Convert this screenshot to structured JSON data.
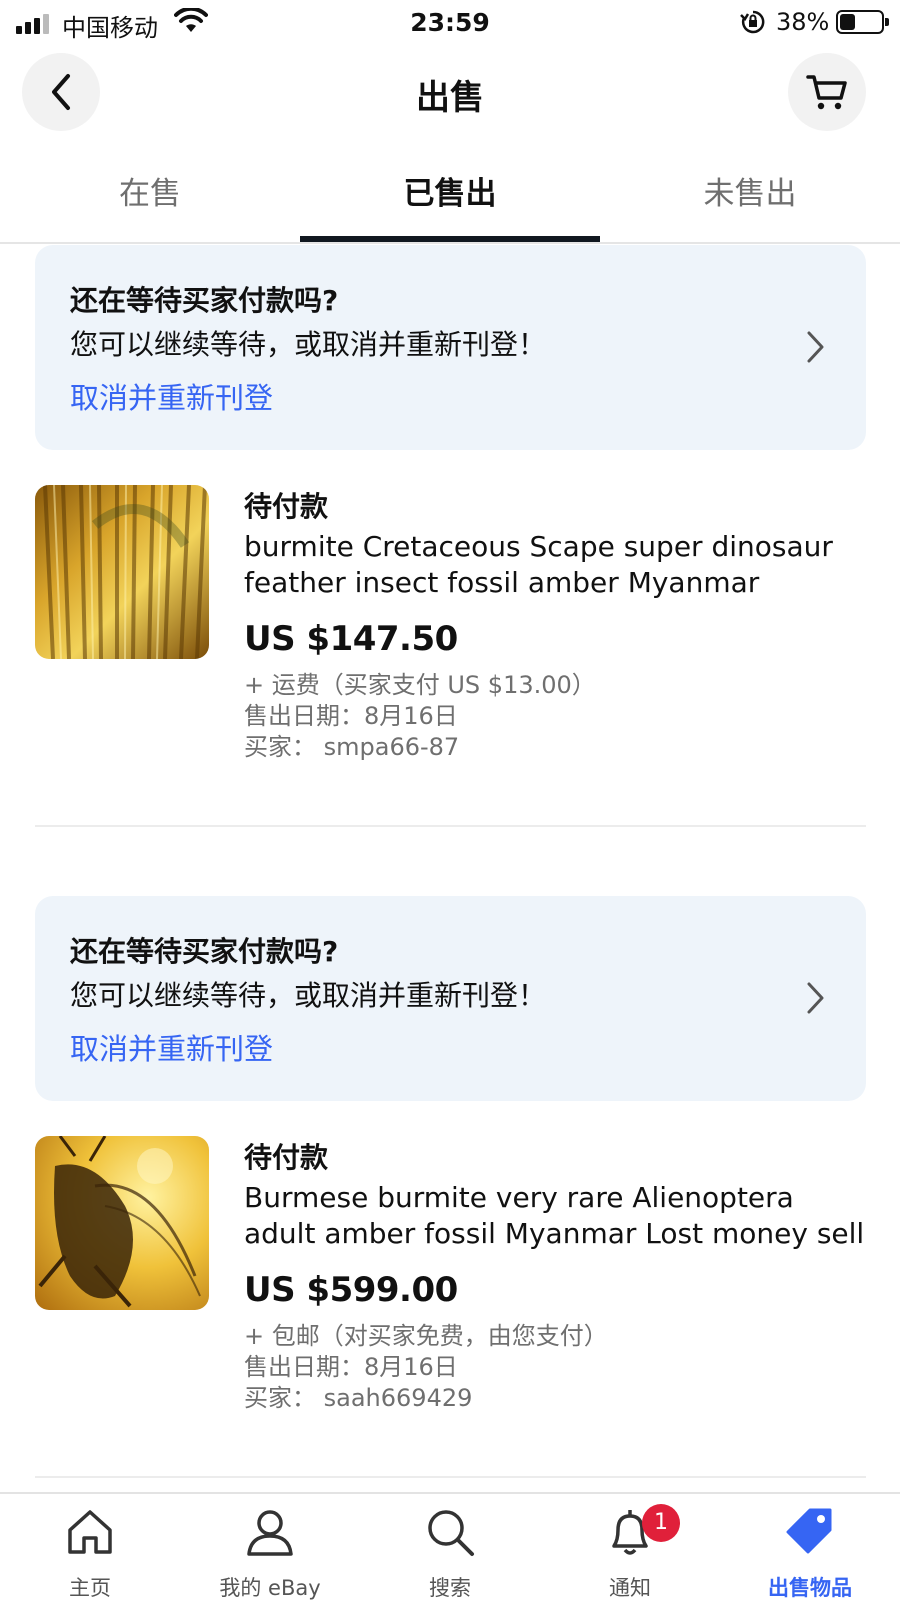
{
  "status_bar": {
    "carrier": "中国移动",
    "time": "23:59",
    "battery_percent": "38%",
    "battery_level": 0.38,
    "icons": [
      "signal-icon",
      "wifi-icon",
      "orientation-lock-icon",
      "battery-icon"
    ]
  },
  "header": {
    "title": "出售",
    "back_icon": "chevron-left-icon",
    "cart_icon": "cart-icon"
  },
  "tabs": [
    {
      "label": "在售",
      "active": false
    },
    {
      "label": "已售出",
      "active": true
    },
    {
      "label": "未售出",
      "active": false
    }
  ],
  "notice": {
    "title": "还在等待买家付款吗?",
    "description": "您可以继续等待，或取消并重新刊登！",
    "link": "取消并重新刊登"
  },
  "listings": [
    {
      "status": "待付款",
      "title": "burmite Cretaceous Scape super dinosaur feather insect fossil amber Myanmar",
      "price": "US $147.50",
      "shipping": "+ 运费（买家支付 US $13.00）",
      "sold_date": "售出日期：8月16日",
      "buyer": "买家：  smpa66-87"
    },
    {
      "status": "待付款",
      "title": "Burmese burmite very rare Alienoptera adult amber fossil Myanmar Lost money sell",
      "price": "US $599.00",
      "shipping": "+ 包邮（对买家免费，由您支付）",
      "sold_date": "售出日期：8月16日",
      "buyer": "买家：  saah669429"
    }
  ],
  "bottom_nav": {
    "items": [
      {
        "label": "主页",
        "icon": "home-icon",
        "active": false
      },
      {
        "label": "我的 eBay",
        "icon": "user-icon",
        "active": false
      },
      {
        "label": "搜索",
        "icon": "search-icon",
        "active": false
      },
      {
        "label": "通知",
        "icon": "bell-icon",
        "active": false,
        "badge": "1"
      },
      {
        "label": "出售物品",
        "icon": "price-tag-icon",
        "active": true
      }
    ]
  },
  "colors": {
    "accent": "#3665f3",
    "notice_bg": "#eef4fa",
    "badge": "#e0203a",
    "text_primary": "#111820",
    "text_secondary": "#6f6f6f"
  }
}
